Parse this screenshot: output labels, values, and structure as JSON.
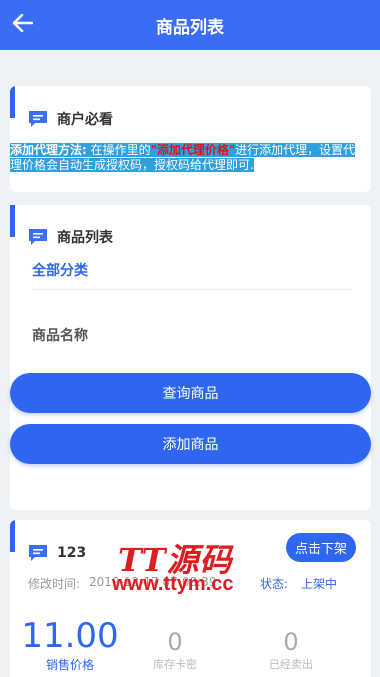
{
  "header": {
    "title": "商品列表",
    "back_icon": "arrow-left-icon"
  },
  "notice_card": {
    "title": "商户必看",
    "icon": "chat-bubble-icon",
    "label": "添加代理方法:",
    "text_before": " 在操作里的",
    "highlight": "\"添加代理价格\"",
    "text_after_line1": "进行添加代理，设置代",
    "text_line2": "理价格会自动生成授权码，授权码给代理即可."
  },
  "filter_card": {
    "title": "商品列表",
    "icon": "chat-bubble-icon",
    "category_value": "全部分类",
    "name_placeholder": "商品名称",
    "query_button": "查询商品",
    "add_button": "添加商品"
  },
  "product": {
    "name": "123",
    "icon": "chat-bubble-icon",
    "delist_button": "点击下架",
    "modified_label": "修改时间:",
    "modified_value": "2019-12-17 07:08:39",
    "status_label": "状态:",
    "status_value": "上架中",
    "price": "11.00",
    "price_label": "销售价格",
    "stock": "0",
    "stock_label": "库存卡密",
    "sold": "0",
    "sold_label": "已经卖出"
  },
  "watermark": {
    "logo_text": "TT源码",
    "url": "www.ttym.cc"
  },
  "colors": {
    "primary": "#2f66f0",
    "header": "#3b6cf4",
    "highlight": "#e3101a",
    "watermark": "#e11b22"
  }
}
